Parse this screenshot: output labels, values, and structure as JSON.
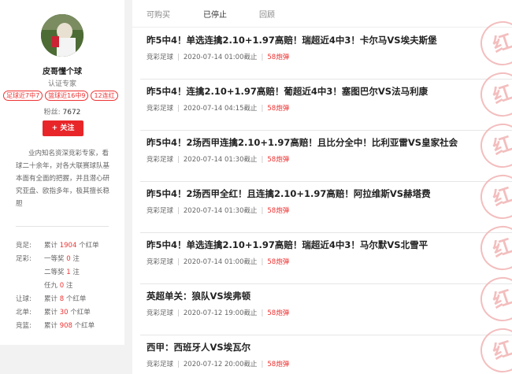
{
  "expert": {
    "name": "皮哥懂个球",
    "title": "认证专家",
    "badges": [
      "足球近7中7",
      "篮球近16中9",
      "12连红"
    ],
    "fans_label": "粉丝:",
    "fans_count": "7672",
    "follow_label": "+ 关注",
    "bio": "业内知名资深竞彩专家，看球二十余年，对各大联赛球队基本面有全面的把握，并且潜心研究亚盘、欧指多年，极其擅长稳胆"
  },
  "stats": [
    {
      "label": "竞足:",
      "pre": "累计",
      "value": "1904",
      "post": "个红单"
    },
    {
      "label": "足彩:",
      "pre": "一等奖",
      "value": "0",
      "post": "注"
    },
    {
      "label": "",
      "pre": "二等奖",
      "value": "1",
      "post": "注"
    },
    {
      "label": "",
      "pre": "任九",
      "value": "0",
      "post": "注"
    },
    {
      "label": "让球:",
      "pre": "累计",
      "value": "8",
      "post": "个红单"
    },
    {
      "label": "北单:",
      "pre": "累计",
      "value": "30",
      "post": "个红单"
    },
    {
      "label": "竞篮:",
      "pre": "累计",
      "value": "908",
      "post": "个红单"
    }
  ],
  "tabs": [
    "可购买",
    "已停止",
    "回顾"
  ],
  "articles": [
    {
      "title": "昨5中4！单选连擒2.10+1.97高赔！瑞超近4中3！卡尔马VS埃夫斯堡",
      "category": "竞彩足球",
      "date": "2020-07-14 01:00截止",
      "price": "58炮弹",
      "stamp": "红"
    },
    {
      "title": "昨5中4！连擒2.10+1.97高赔！葡超近4中3！塞图巴尔VS法马利康",
      "category": "竞彩足球",
      "date": "2020-07-14 04:15截止",
      "price": "58炮弹",
      "stamp": "红"
    },
    {
      "title": "昨5中4！2场西甲连擒2.10+1.97高赔！且比分全中！比利亚雷VS皇家社会",
      "category": "竞彩足球",
      "date": "2020-07-14 01:30截止",
      "price": "58炮弹",
      "stamp": "红"
    },
    {
      "title": "昨5中4！2场西甲全红！且连擒2.10+1.97高赔！阿拉维斯VS赫塔费",
      "category": "竞彩足球",
      "date": "2020-07-14 01:30截止",
      "price": "58炮弹",
      "stamp": "红"
    },
    {
      "title": "昨5中4！单选连擒2.10+1.97高赔！瑞超近4中3！马尔默VS北雪平",
      "category": "竞彩足球",
      "date": "2020-07-14 01:00截止",
      "price": "58炮弹",
      "stamp": "红"
    },
    {
      "title": "英超单关：狼队VS埃弗顿",
      "category": "竞彩足球",
      "date": "2020-07-12 19:00截止",
      "price": "58炮弹",
      "stamp": "红"
    },
    {
      "title": "西甲：西班牙人VS埃瓦尔",
      "category": "竞彩足球",
      "date": "2020-07-12 20:00截止",
      "price": "58炮弹",
      "stamp": "红"
    }
  ]
}
